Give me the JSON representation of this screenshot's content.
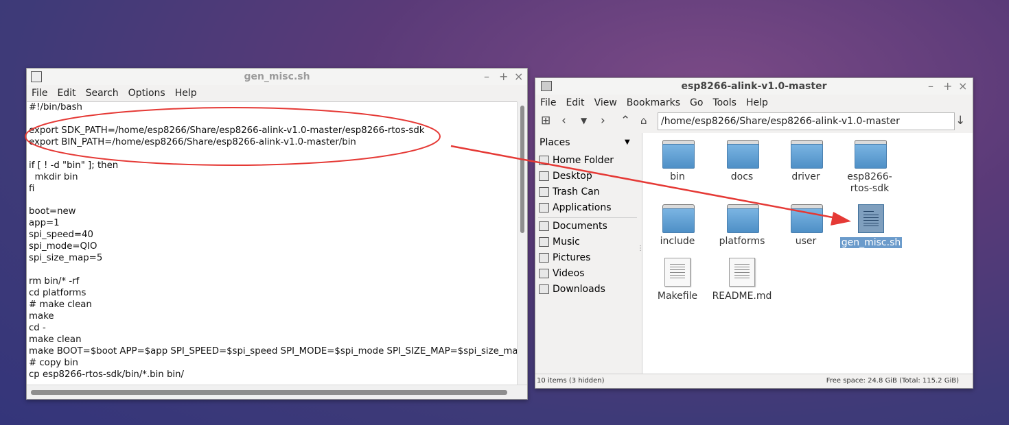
{
  "editor": {
    "title": "gen_misc.sh",
    "menu": [
      "File",
      "Edit",
      "Search",
      "Options",
      "Help"
    ],
    "lines": [
      "#!/bin/bash",
      "",
      "export SDK_PATH=/home/esp8266/Share/esp8266-alink-v1.0-master/esp8266-rtos-sdk",
      "export BIN_PATH=/home/esp8266/Share/esp8266-alink-v1.0-master/bin",
      "",
      "if [ ! -d \"bin\" ]; then",
      "  mkdir bin",
      "fi",
      "",
      "boot=new",
      "app=1",
      "spi_speed=40",
      "spi_mode=QIO",
      "spi_size_map=5",
      "",
      "rm bin/* -rf",
      "cd platforms",
      "# make clean",
      "make",
      "cd -",
      "make clean",
      "make BOOT=$boot APP=$app SPI_SPEED=$spi_speed SPI_MODE=$spi_mode SPI_SIZE_MAP=$spi_size_ma",
      "# copy bin",
      "cp esp8266-rtos-sdk/bin/*.bin bin/"
    ]
  },
  "file_manager": {
    "title": "esp8266-alink-v1.0-master",
    "menu": [
      "File",
      "Edit",
      "View",
      "Bookmarks",
      "Go",
      "Tools",
      "Help"
    ],
    "path": "/home/esp8266/Share/esp8266-alink-v1.0-master",
    "sidebar_header": "Places",
    "sidebar_items": [
      "Home Folder",
      "Desktop",
      "Trash Can",
      "Applications",
      "Documents",
      "Music",
      "Pictures",
      "Videos",
      "Downloads"
    ],
    "items": [
      {
        "label": "bin",
        "type": "folder"
      },
      {
        "label": "docs",
        "type": "folder"
      },
      {
        "label": "driver",
        "type": "folder"
      },
      {
        "label": "esp8266-rtos-sdk",
        "type": "folder"
      },
      {
        "label": "include",
        "type": "folder"
      },
      {
        "label": "platforms",
        "type": "folder"
      },
      {
        "label": "user",
        "type": "folder"
      },
      {
        "label": "gen_misc.sh",
        "type": "script",
        "selected": true
      },
      {
        "label": "Makefile",
        "type": "file"
      },
      {
        "label": "README.md",
        "type": "file"
      }
    ],
    "status_left": "10 items (3 hidden)",
    "status_right": "Free space: 24.8 GiB (Total: 115.2 GiB)"
  },
  "annotation_color": "#e53935"
}
